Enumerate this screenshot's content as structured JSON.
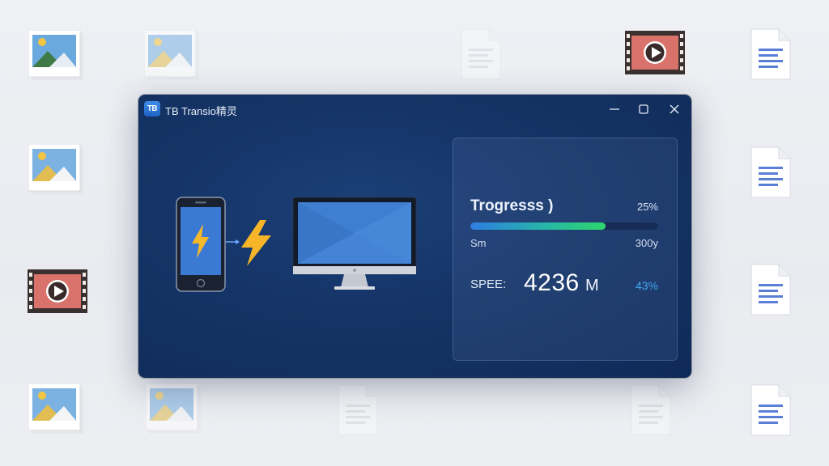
{
  "window": {
    "logo_text": "TB",
    "title": "TB Transio精灵",
    "controls": [
      "minimize",
      "maximize",
      "close"
    ]
  },
  "transfer": {
    "source_icon": "smartphone-icon",
    "connector_icon": "lightning-bolt-icon",
    "target_icon": "desktop-monitor-icon"
  },
  "progress": {
    "label": "Trogresss )",
    "percent_label": "25%",
    "fill_fraction": 0.72,
    "left_text": "Sm",
    "right_text": "300y"
  },
  "speed": {
    "label": "SPEE:",
    "value": "4236",
    "unit": "M",
    "percent": "43%"
  },
  "background_icons": [
    "image-file-icon",
    "image-file-icon",
    "document-icon",
    "video-file-icon",
    "document-icon",
    "image-file-icon",
    "document-icon",
    "video-file-icon",
    "document-icon",
    "image-file-icon",
    "image-file-icon",
    "document-icon",
    "document-icon",
    "document-icon"
  ],
  "colors": {
    "window_bg": "#153568",
    "progress_start": "#2e7de0",
    "progress_end": "#2ed66c",
    "speed_percent": "#44a8f0",
    "accent_bolt": "#f5b82a"
  }
}
